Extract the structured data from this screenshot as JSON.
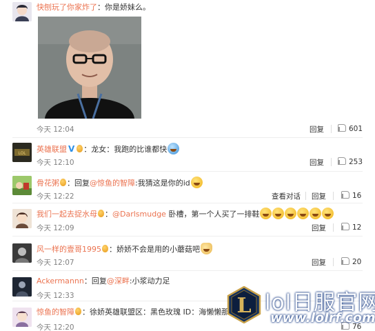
{
  "labels": {
    "reply": "回复",
    "view_conversation": "查看对话"
  },
  "comments": [
    {
      "user": "快刨玩了你家炸了",
      "sep": "：",
      "text": "你是娇妹么。",
      "time": "今天 12:04",
      "likes": "601"
    },
    {
      "user": "英雄联盟",
      "sep": "：",
      "text": "龙女：我跑的比谁都快",
      "time": "今天 12:10",
      "likes": "253"
    },
    {
      "user": "骨花粥",
      "sep": "：",
      "reply_prefix": "回复",
      "mention": "@惊鱼的智障",
      "text": ":我猜这是你的id",
      "time": "今天 12:22",
      "likes": "16"
    },
    {
      "user": "我们一起去捉水母",
      "sep": "：",
      "mention": "@Darlsmudge",
      "text": " 卧槽，第一个人买了一排鞋",
      "time": "今天 12:09",
      "likes": "12"
    },
    {
      "user": "风一样的壹哥1995",
      "sep": "：",
      "text": "娇娇不会是用的小蘑菇吧",
      "time": "今天 12:07",
      "likes": "20"
    },
    {
      "user": "Ackermannn",
      "sep": "：",
      "reply_prefix": "回复",
      "mention": "@深畔",
      "text": ":小浆动力足",
      "time": "今天 12:33",
      "likes": ""
    },
    {
      "user": "惊鱼的智障",
      "sep": "：",
      "text": "徐娇英雄联盟区：黑色玫瑰 ID：海懒懒那",
      "time": "今天 12:20",
      "likes": "76"
    }
  ],
  "watermark": {
    "title": "lol日服官网",
    "url": "www.lolrf.com",
    "logo": "L"
  },
  "icons": {
    "thumb": "thumbs-up-icon",
    "badge": "medal-badge-icon",
    "verified": "V"
  }
}
